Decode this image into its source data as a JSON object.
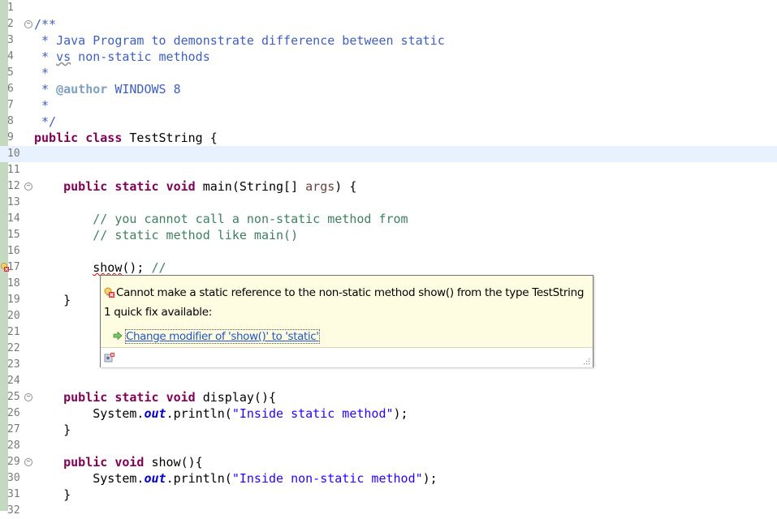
{
  "editor": {
    "lines": [
      {
        "num": "1",
        "segments": []
      },
      {
        "num": "2",
        "fold": true,
        "segments": [
          {
            "t": "/**",
            "c": "doc"
          }
        ]
      },
      {
        "num": "3",
        "segments": [
          {
            "t": " * Java Program to demonstrate difference between static",
            "c": "doc"
          }
        ]
      },
      {
        "num": "4",
        "segments": [
          {
            "t": " * ",
            "c": "doc"
          },
          {
            "t": "vs",
            "c": "doc squiggle-warn"
          },
          {
            "t": " non-static methods",
            "c": "doc"
          }
        ]
      },
      {
        "num": "5",
        "segments": [
          {
            "t": " *",
            "c": "doc"
          }
        ]
      },
      {
        "num": "6",
        "segments": [
          {
            "t": " * ",
            "c": "doc"
          },
          {
            "t": "@author",
            "c": "tag"
          },
          {
            "t": " WINDOWS 8",
            "c": "doc"
          }
        ]
      },
      {
        "num": "7",
        "segments": [
          {
            "t": " *",
            "c": "doc"
          }
        ]
      },
      {
        "num": "8",
        "segments": [
          {
            "t": " */",
            "c": "doc"
          }
        ]
      },
      {
        "num": "9",
        "segments": [
          {
            "t": "public",
            "c": "kw"
          },
          {
            "t": " "
          },
          {
            "t": "class",
            "c": "kw"
          },
          {
            "t": " TestString {"
          }
        ]
      },
      {
        "num": "10",
        "current": true,
        "segments": []
      },
      {
        "num": "11",
        "segments": []
      },
      {
        "num": "12",
        "fold": true,
        "segments": [
          {
            "t": "    "
          },
          {
            "t": "public",
            "c": "kw"
          },
          {
            "t": " "
          },
          {
            "t": "static",
            "c": "kw"
          },
          {
            "t": " "
          },
          {
            "t": "void",
            "c": "kw"
          },
          {
            "t": " main(String[] "
          },
          {
            "t": "args",
            "c": "param"
          },
          {
            "t": ") {"
          }
        ]
      },
      {
        "num": "13",
        "segments": []
      },
      {
        "num": "14",
        "segments": [
          {
            "t": "        "
          },
          {
            "t": "// you cannot call a non-static method from",
            "c": "cm"
          }
        ]
      },
      {
        "num": "15",
        "segments": [
          {
            "t": "        "
          },
          {
            "t": "// static method like main()",
            "c": "cm"
          }
        ]
      },
      {
        "num": "16",
        "segments": []
      },
      {
        "num": "17",
        "error": true,
        "segments": [
          {
            "t": "        "
          },
          {
            "t": "show",
            "c": "squiggle"
          },
          {
            "t": "();",
            "c": ""
          },
          {
            "t": " //",
            "c": "cm"
          }
        ]
      },
      {
        "num": "18",
        "segments": []
      },
      {
        "num": "19",
        "segments": [
          {
            "t": "    }"
          }
        ]
      },
      {
        "num": "20",
        "segments": []
      },
      {
        "num": "21",
        "segments": []
      },
      {
        "num": "22",
        "segments": []
      },
      {
        "num": "23",
        "segments": []
      },
      {
        "num": "24",
        "segments": []
      },
      {
        "num": "25",
        "fold": true,
        "segments": [
          {
            "t": "    "
          },
          {
            "t": "public",
            "c": "kw"
          },
          {
            "t": " "
          },
          {
            "t": "static",
            "c": "kw"
          },
          {
            "t": " "
          },
          {
            "t": "void",
            "c": "kw"
          },
          {
            "t": " display(){"
          }
        ]
      },
      {
        "num": "26",
        "segments": [
          {
            "t": "        System."
          },
          {
            "t": "out",
            "c": "fld"
          },
          {
            "t": ".println("
          },
          {
            "t": "\"Inside static method\"",
            "c": "str"
          },
          {
            "t": ");"
          }
        ]
      },
      {
        "num": "27",
        "segments": [
          {
            "t": "    }"
          }
        ]
      },
      {
        "num": "28",
        "segments": []
      },
      {
        "num": "29",
        "fold": true,
        "segments": [
          {
            "t": "    "
          },
          {
            "t": "public",
            "c": "kw"
          },
          {
            "t": " "
          },
          {
            "t": "void",
            "c": "kw"
          },
          {
            "t": " show(){"
          }
        ]
      },
      {
        "num": "30",
        "segments": [
          {
            "t": "        System."
          },
          {
            "t": "out",
            "c": "fld"
          },
          {
            "t": ".println("
          },
          {
            "t": "\"Inside non-static method\"",
            "c": "str"
          },
          {
            "t": ");"
          }
        ]
      },
      {
        "num": "31",
        "segments": [
          {
            "t": "    }"
          }
        ]
      },
      {
        "num": "32",
        "segments": []
      }
    ]
  },
  "popup": {
    "message": "Cannot make a static reference to the non-static method show() from the type TestString",
    "quick_fix_count": "1 quick fix available:",
    "fix_label": "Change modifier of 'show()' to 'static'"
  },
  "colors": {
    "keyword": "#7f0055",
    "javadoc": "#3f5fbf",
    "comment": "#3f7f5f",
    "string": "#2a00ff",
    "field": "#0000c0",
    "popup_bg": "#fffde1",
    "link": "#1e55c8"
  },
  "icons": {
    "error_marker": "error-lightbulb-icon",
    "popup_error": "error-lightbulb-icon",
    "fix_arrow": "green-arrow-icon",
    "footer": "configure-problem-icon",
    "grip": "resize-grip-icon"
  }
}
